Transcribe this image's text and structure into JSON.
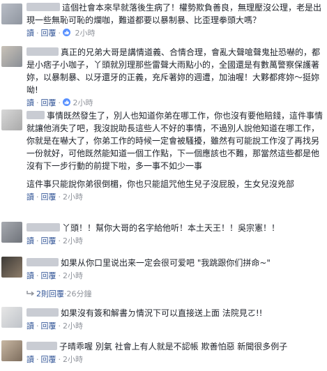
{
  "comments": [
    {
      "text": "這個社會本來早就落後生病了！權勢欺負善良，無理壓沒公理，老是出現一些無恥可恥的爛咖，難道都要以暴制暴、比歪理拳頭大嗎？",
      "read_label": "讀",
      "reply_label": "回覆",
      "time": "2小時"
    },
    {
      "text": "真正的兄弟大哥是講情道義、合情合理，會亂大聲嗆聲鬼扯恐嚇的，都是小痞子小咖子，丫頭就別理那些雷聲大雨點小的，全國還是有數萬警察保護著妳，以暴制暴、以牙還牙的正義，充斥著妳的週遭，加油喔！大夥都疼妳～挺妳呦!",
      "read_label": "讀",
      "reply_label": "回覆",
      "time": "2小時"
    },
    {
      "text": "事情既然發生了，別人也知道你弟在哪工作，你也沒有要他賠錢，這件事情就讓他消失了吧，我沒說助長這些人不好的事情，不過別人說他知道在哪工作，你就是在嚇大了，你弟工作的時候一定會被騷擾，雖然有可能說工作沒了再找另一份就好，可他既然能知道一個工作點，下一個應該也不難，那當然這些都是他沒有下一步行動的前提下啦，多一事不如少一事",
      "text2": "這件事只能說你弟很倒楣，你也只能詛咒他生兒子沒屁股，生女兒沒兇部",
      "read_label": "讀",
      "reply_label": "回覆",
      "time": "2小時"
    },
    {
      "text": "丫頭！！幫你大哥的名字給他听！本土天王！！吳宗憲！！",
      "read_label": "讀",
      "reply_label": "回覆",
      "time": "2小時"
    },
    {
      "text": "如果从你口里说出来一定会很可爱吧 \"我跳跟你们拼命~\"",
      "read_label": "讀",
      "reply_label": "回覆",
      "time": "2小時",
      "replies_link": "2則回覆",
      "replies_time": "26分鐘"
    },
    {
      "text": "如果沒有簽和解書ㄉ情況下可以直接送上面 法院見ㄛ!!",
      "read_label": "讀",
      "reply_label": "回覆",
      "time": "2小時"
    },
    {
      "text": "子晴乖喔 別氣 社會上有人就是不認帳 欺善怕惡 新聞很多例子",
      "read_label": "讀",
      "reply_label": "回覆",
      "time": "2小時"
    }
  ]
}
